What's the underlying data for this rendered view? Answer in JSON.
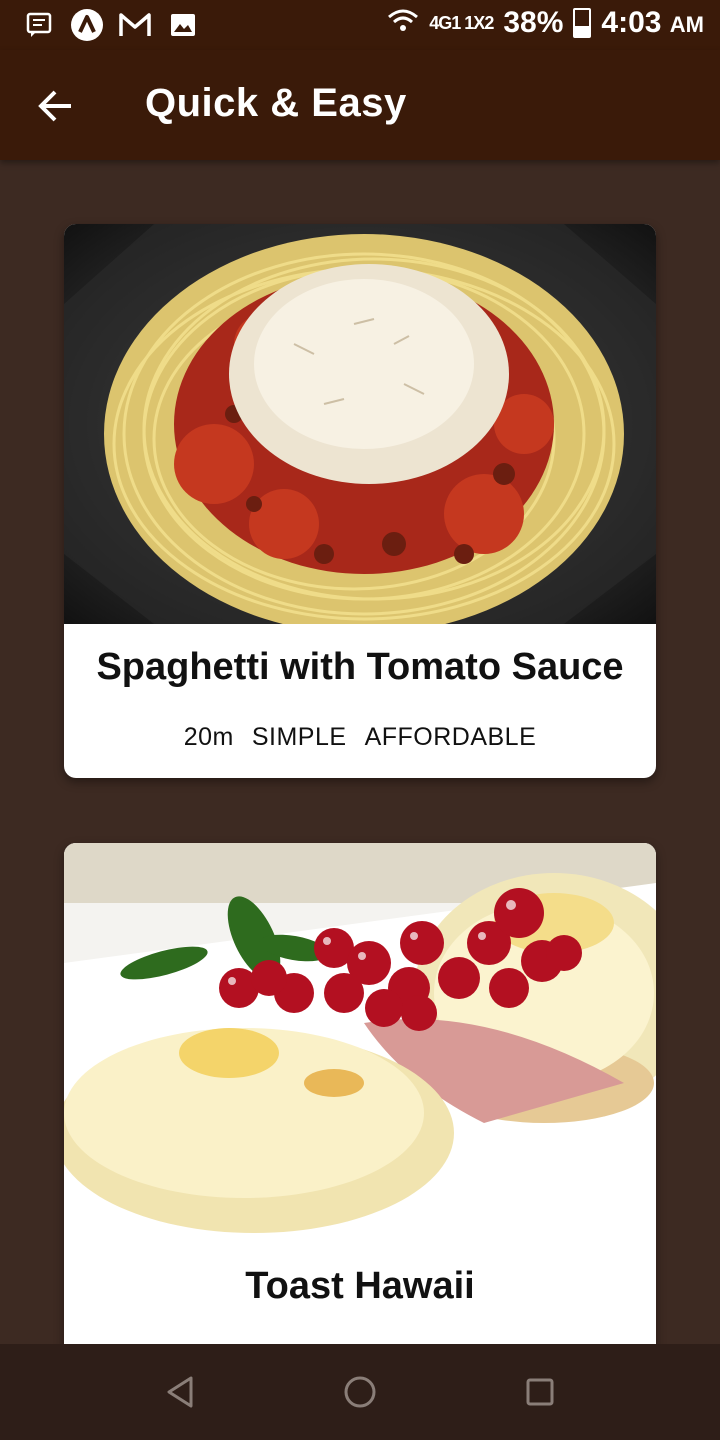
{
  "status_bar": {
    "network_label": "4G",
    "sim1_label": "1",
    "network2_label": "1X",
    "sim2_label": "2",
    "battery_text": "38%",
    "battery_level": 0.38,
    "time": "4:03",
    "ampm": "AM",
    "icons": [
      "message-icon",
      "app-a-icon",
      "gmail-icon",
      "image-icon",
      "wifi-icon",
      "signal-icon",
      "battery-icon"
    ]
  },
  "app_bar": {
    "title": "Quick & Easy",
    "back_icon": "arrow-left-icon"
  },
  "meals": [
    {
      "title": "Spaghetti with Tomato Sauce",
      "duration": "20m",
      "complexity": "SIMPLE",
      "affordability": "AFFORDABLE"
    },
    {
      "title": "Toast Hawaii"
    }
  ],
  "nav_bar": {
    "icons": [
      "back-triangle-icon",
      "home-circle-icon",
      "recents-square-icon"
    ]
  },
  "colors": {
    "app_bar": "#3a1a09",
    "background": "#3d2a22",
    "card": "#ffffff"
  }
}
